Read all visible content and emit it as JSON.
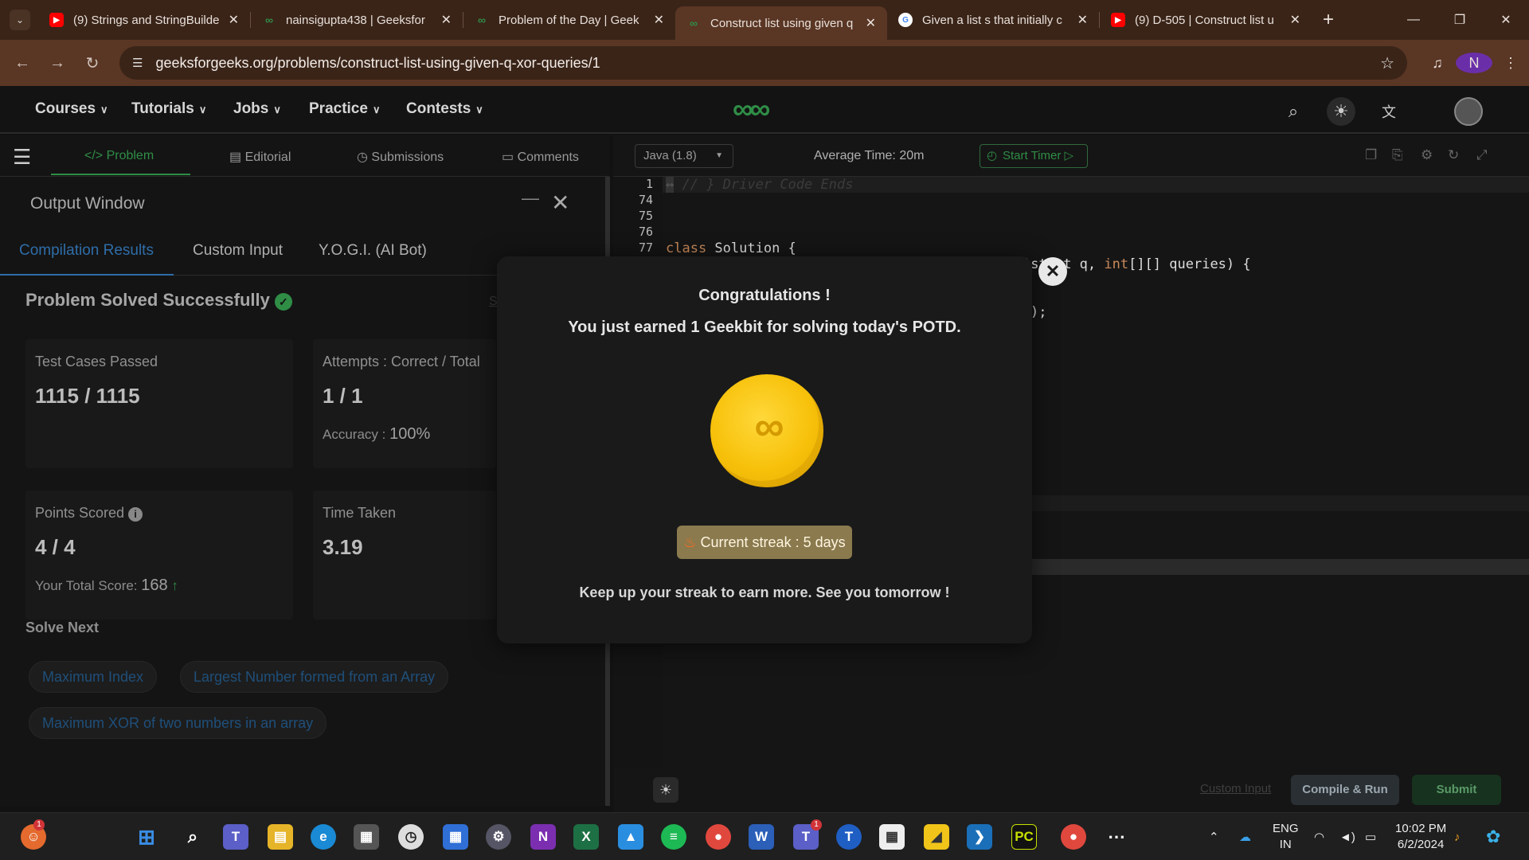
{
  "browser": {
    "tabs": [
      {
        "title": "(9) Strings and StringBuilde",
        "favicon": "youtube-icon"
      },
      {
        "title": "nainsigupta438 | Geeksfor",
        "favicon": "gfg-icon"
      },
      {
        "title": "Problem of the Day | Geek",
        "favicon": "gfg-icon"
      },
      {
        "title": "Construct list using given q",
        "favicon": "gfg-icon",
        "active": true
      },
      {
        "title": "Given a list s that initially c",
        "favicon": "google-icon"
      },
      {
        "title": "(9) D-505 | Construct list u",
        "favicon": "youtube-icon"
      }
    ],
    "url": "geeksforgeeks.org/problems/construct-list-using-given-q-xor-queries/1",
    "profile_initial": "N"
  },
  "site": {
    "nav": [
      "Courses",
      "Tutorials",
      "Jobs",
      "Practice",
      "Contests"
    ],
    "logo": "GG"
  },
  "subnav": {
    "tabs": [
      "Problem",
      "Editorial",
      "Submissions",
      "Comments"
    ]
  },
  "output": {
    "title": "Output Window",
    "tabs": [
      "Compilation Results",
      "Custom Input",
      "Y.O.G.I. (AI Bot)"
    ],
    "status": "Problem Solved Successfully",
    "cards": {
      "test_cases_label": "Test Cases Passed",
      "test_cases_value": "1115 / 1115",
      "attempts_label": "Attempts : Correct / Total",
      "attempts_value": "1 / 1",
      "accuracy_label": "Accuracy :",
      "accuracy_value": "100%",
      "points_label": "Points Scored",
      "points_value": "4 / 4",
      "total_score_label": "Your Total Score:",
      "total_score_value": "168",
      "time_label": "Time Taken",
      "time_value": "3.19"
    },
    "solve_next_label": "Solve Next",
    "solve_next": [
      "Maximum Index",
      "Largest Number formed from an Array",
      "Maximum XOR of two numbers in an array"
    ],
    "partial_link": "S"
  },
  "editor": {
    "language": "Java (1.8)",
    "avg_time": "Average Time: 20m",
    "timer_label": "Start Timer",
    "line_numbers": [
      "1",
      "74",
      "75",
      "76",
      "77"
    ],
    "code": {
      "l1": "// } Driver Code Ends",
      "l77_kw": "class",
      "l77_rest": " Solution {",
      "l78_a": "ist<",
      "l78_b": "nt q, ",
      "l78_kw": "int",
      "l78_c": "[][] queries) {",
      "l81": ");"
    },
    "custom_input": "Custom Input",
    "compile_run": "Compile & Run",
    "submit": "Submit"
  },
  "modal": {
    "title": "Congratulations !",
    "subtitle": "You just earned 1 Geekbit for solving today's POTD.",
    "streak": "Current streak : 5 days",
    "footer": "Keep up your streak to earn more. See you tomorrow !"
  },
  "taskbar": {
    "lang_top": "ENG",
    "lang_bottom": "IN",
    "time": "10:02 PM",
    "date": "6/2/2024",
    "teams_badge": "1",
    "phone_badge": "1"
  }
}
